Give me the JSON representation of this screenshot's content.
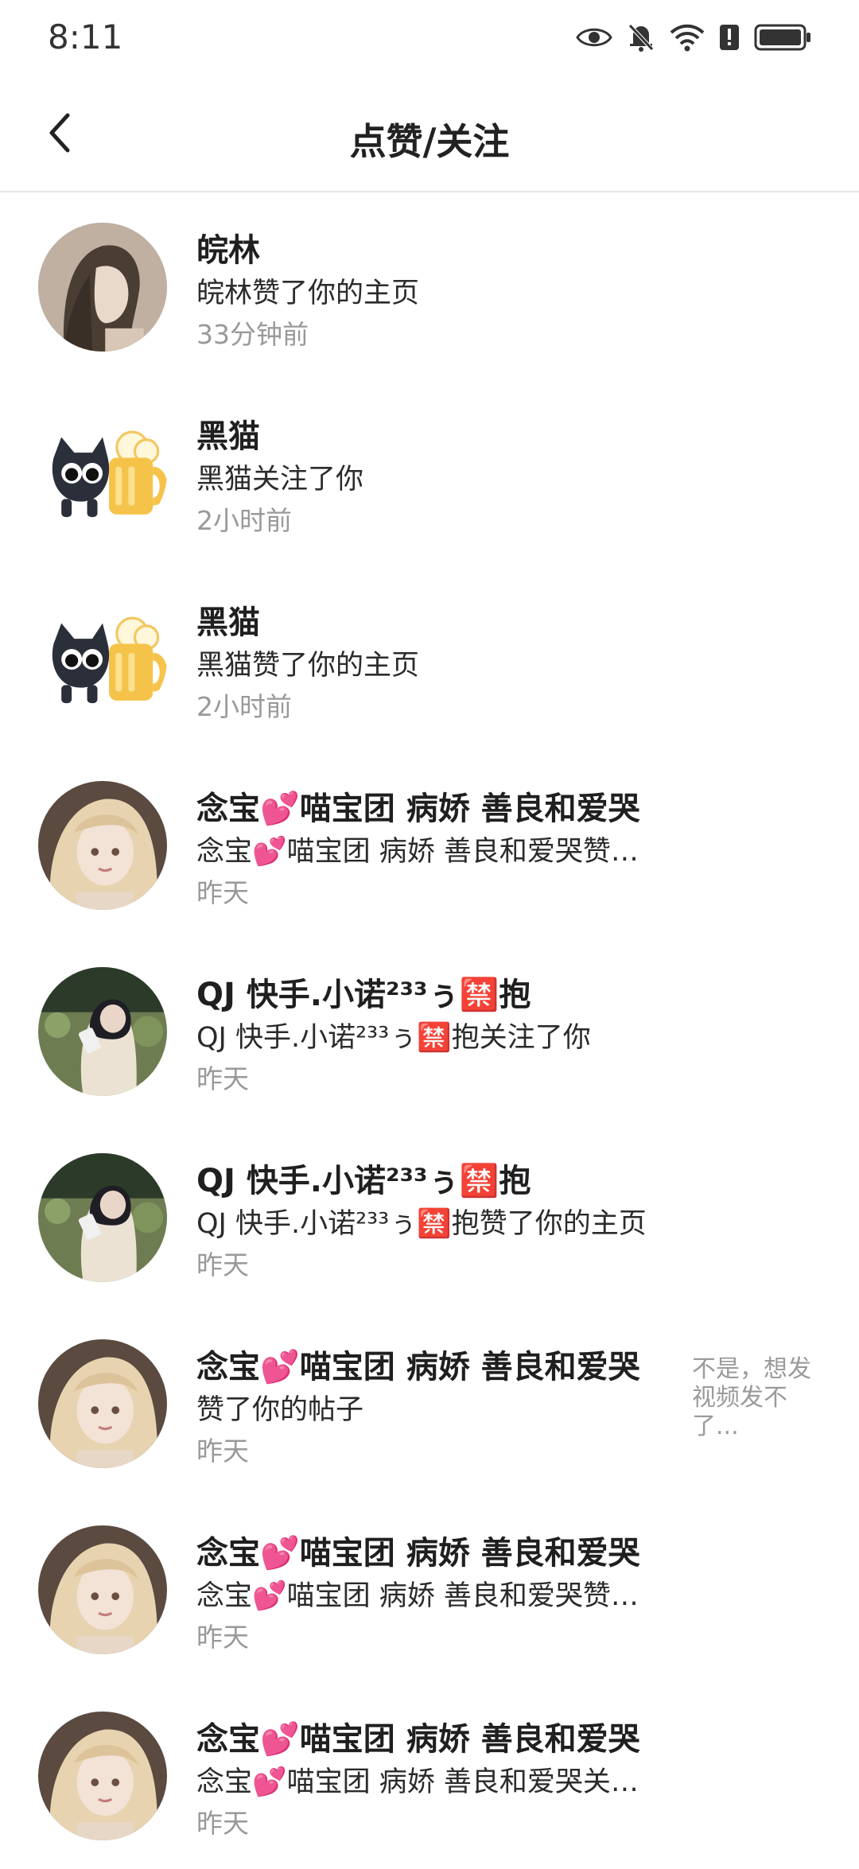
{
  "status_bar": {
    "time": "8:11",
    "icons": [
      "eye-icon",
      "bell-muted-icon",
      "wifi-icon",
      "alert-icon",
      "battery-icon"
    ]
  },
  "header": {
    "title": "点赞/关注",
    "back_icon": "chevron-left-icon"
  },
  "notifications": [
    {
      "avatar": "woman-hair-profile",
      "name": "皖林",
      "action": "皖林赞了你的主页",
      "time": "33分钟前",
      "preview": ""
    },
    {
      "avatar": "black-cat-beer",
      "name": "黑猫",
      "action": "黑猫关注了你",
      "time": "2小时前",
      "preview": ""
    },
    {
      "avatar": "black-cat-beer",
      "name": "黑猫",
      "action": "黑猫赞了你的主页",
      "time": "2小时前",
      "preview": ""
    },
    {
      "avatar": "blonde-doll",
      "name": "念宝💕喵宝团 病娇 善良和爱哭",
      "action": "念宝💕喵宝团 病娇 善良和爱哭赞…",
      "time": "昨天",
      "preview": ""
    },
    {
      "avatar": "girl-phone-street",
      "name": "QJ 快手.小诺²³³ぅ🈲抱",
      "action": "QJ 快手.小诺²³³ぅ🈲抱关注了你",
      "time": "昨天",
      "preview": ""
    },
    {
      "avatar": "girl-phone-street",
      "name": "QJ 快手.小诺²³³ぅ🈲抱",
      "action": "QJ 快手.小诺²³³ぅ🈲抱赞了你的主页",
      "time": "昨天",
      "preview": ""
    },
    {
      "avatar": "blonde-doll",
      "name": "念宝💕喵宝团 病娇 善良和爱哭",
      "action": "赞了你的帖子",
      "time": "昨天",
      "preview": "不是，想发视频发不了..."
    },
    {
      "avatar": "blonde-doll",
      "name": "念宝💕喵宝团 病娇 善良和爱哭",
      "action": "念宝💕喵宝团 病娇 善良和爱哭赞…",
      "time": "昨天",
      "preview": ""
    },
    {
      "avatar": "blonde-doll",
      "name": "念宝💕喵宝团 病娇 善良和爱哭",
      "action": "念宝💕喵宝团 病娇 善良和爱哭关…",
      "time": "昨天",
      "preview": ""
    }
  ]
}
